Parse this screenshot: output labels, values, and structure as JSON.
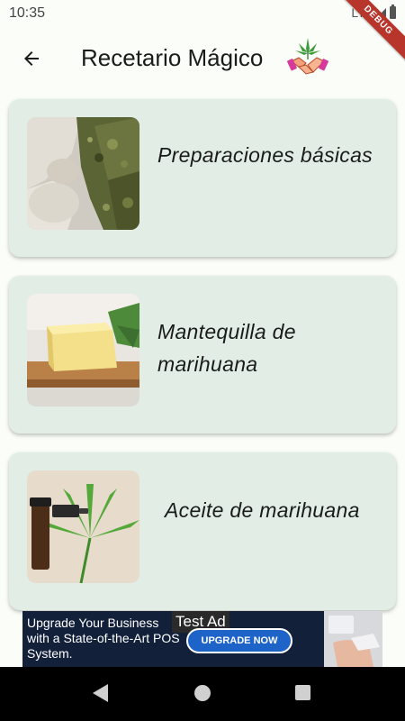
{
  "status_bar": {
    "time": "10:35",
    "network": "LTE",
    "debug_label": "DEBUG"
  },
  "app_bar": {
    "title": "Recetario Mágico",
    "back_icon": "arrow-left-icon",
    "logo_icon": "cannabis-handshake-logo"
  },
  "recipes": [
    {
      "title": "Preparaciones básicas",
      "image": "ground-herb-thumbnail"
    },
    {
      "title": "Mantequilla de marihuana",
      "image": "butter-block-thumbnail"
    },
    {
      "title": "Aceite de marihuana",
      "image": "oil-dropper-leaf-thumbnail"
    }
  ],
  "ad": {
    "text": "Upgrade Your Business with a State-of-the-Art POS System.",
    "label": "Test Ad",
    "cta": "UPGRADE NOW"
  },
  "nav_bar": {
    "back_icon": "nav-back-icon",
    "home_icon": "nav-home-icon",
    "recents_icon": "nav-recents-icon"
  },
  "colors": {
    "background": "#fafdf8",
    "card": "#e2ede6",
    "ribbon": "#b8352c",
    "ad_background": "#12203a",
    "ad_button": "#1e63c7"
  }
}
